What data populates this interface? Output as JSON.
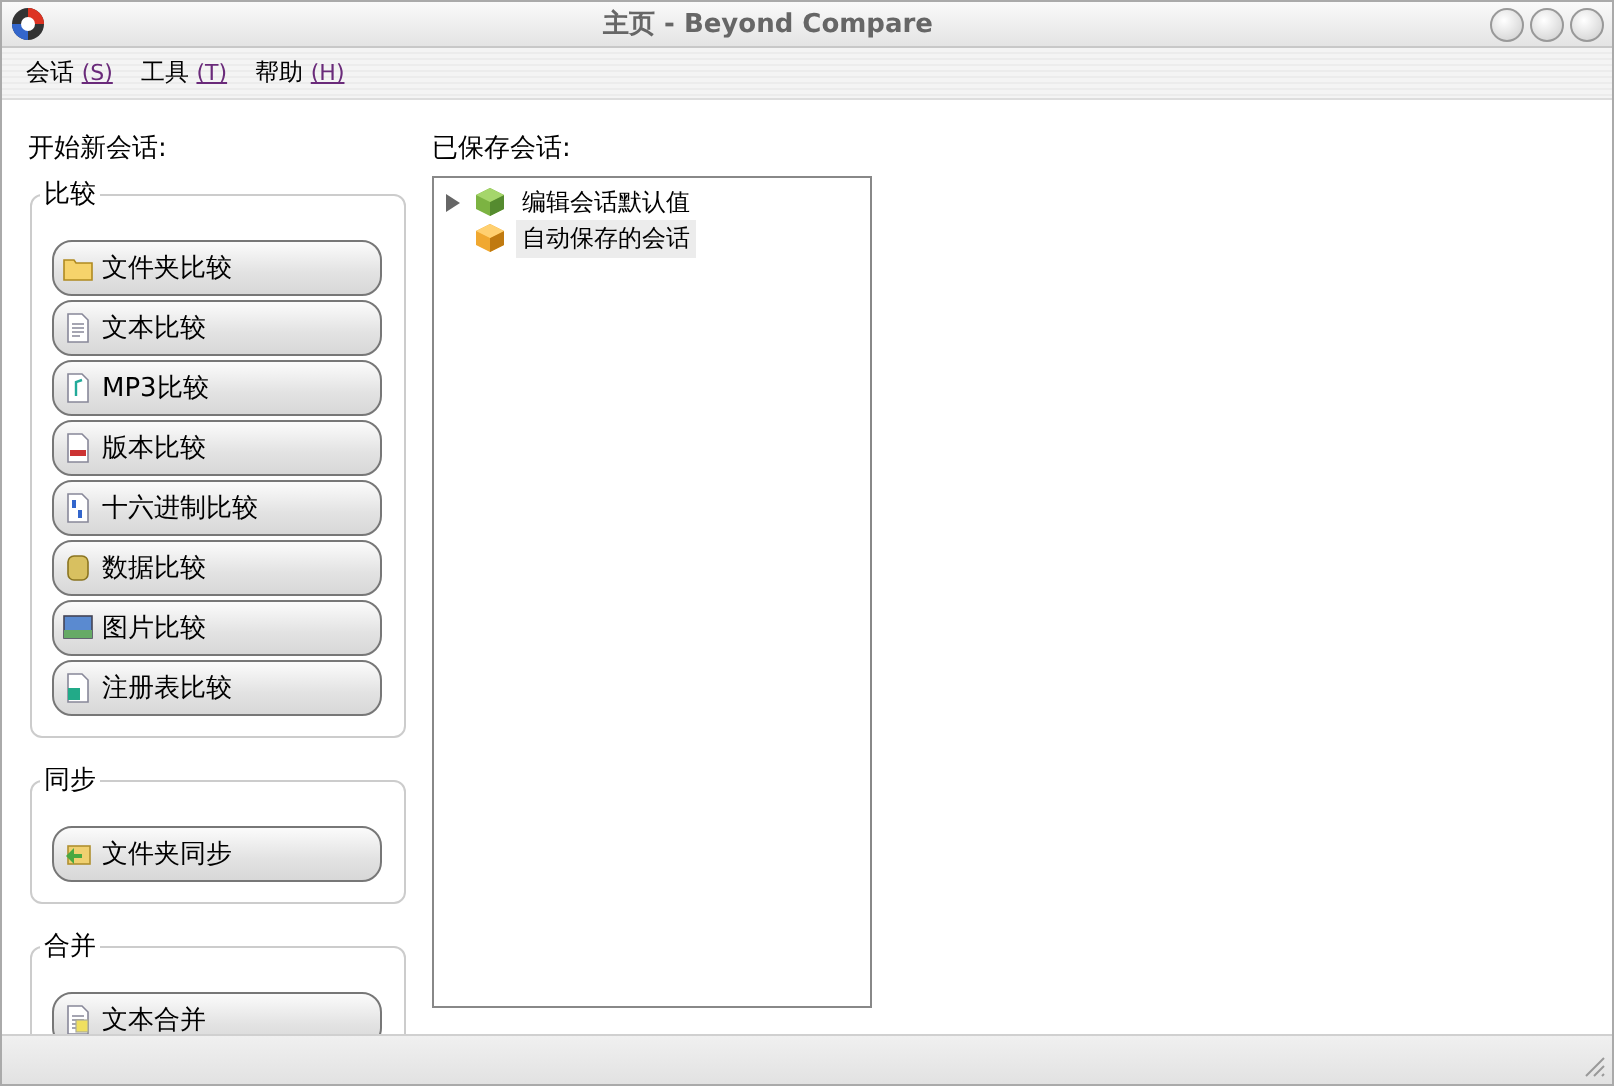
{
  "window": {
    "title": "主页 - Beyond Compare"
  },
  "menu": [
    {
      "label": "会话",
      "hotkey": "(S)"
    },
    {
      "label": "工具",
      "hotkey": "(T)"
    },
    {
      "label": "帮助",
      "hotkey": "(H)"
    }
  ],
  "new_session": {
    "heading": "开始新会话:",
    "groups": [
      {
        "title": "比较",
        "buttons": [
          {
            "label": "文件夹比较",
            "kind": "folder"
          },
          {
            "label": "文本比较",
            "kind": "text"
          },
          {
            "label": "MP3比较",
            "kind": "mp3"
          },
          {
            "label": "版本比较",
            "kind": "version"
          },
          {
            "label": "十六进制比较",
            "kind": "hex"
          },
          {
            "label": "数据比较",
            "kind": "data"
          },
          {
            "label": "图片比较",
            "kind": "picture"
          },
          {
            "label": "注册表比较",
            "kind": "registry"
          }
        ]
      },
      {
        "title": "同步",
        "buttons": [
          {
            "label": "文件夹同步",
            "kind": "sync"
          }
        ]
      },
      {
        "title": "合并",
        "buttons": [
          {
            "label": "文本合并",
            "kind": "merge"
          }
        ]
      }
    ]
  },
  "saved_sessions": {
    "heading": "已保存会话:",
    "items": [
      {
        "label": "编辑会话默认值",
        "kind": "defaults",
        "expandable": true,
        "selected": false
      },
      {
        "label": "自动保存的会话",
        "kind": "autosave",
        "expandable": false,
        "selected": true
      }
    ]
  }
}
